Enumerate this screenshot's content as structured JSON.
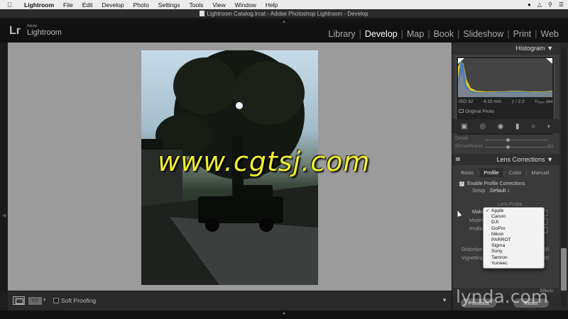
{
  "menubar": {
    "apple_icon": "apple-icon",
    "items": [
      "Lightroom",
      "File",
      "Edit",
      "Develop",
      "Photo",
      "Settings",
      "Tools",
      "View",
      "Window",
      "Help"
    ]
  },
  "window": {
    "title": "Lightroom Catalog.lrcat - Adobe Photoshop Lightroom - Develop"
  },
  "identity": {
    "logo": "Lr",
    "brand_small": "Adobe",
    "brand": "Lightroom"
  },
  "modules": {
    "items": [
      {
        "label": "Library",
        "active": false
      },
      {
        "label": "Develop",
        "active": true
      },
      {
        "label": "Map",
        "active": false
      },
      {
        "label": "Book",
        "active": false
      },
      {
        "label": "Slideshow",
        "active": false
      },
      {
        "label": "Print",
        "active": false
      },
      {
        "label": "Web",
        "active": false
      }
    ]
  },
  "histogram": {
    "title": "Histogram",
    "iso": "ISO 32",
    "focal": "4.15 mm",
    "aperture": "ƒ / 2.2",
    "shutter": "¹⁄₂₅₆₀ sec",
    "original_photo": "Original Photo"
  },
  "basic": {
    "detail_label": "Detail",
    "smoothness_label": "Smoothness",
    "smoothness_value": "50"
  },
  "lens_corrections": {
    "title": "Lens Corrections",
    "tabs": [
      {
        "label": "Basic",
        "active": false
      },
      {
        "label": "Profile",
        "active": true
      },
      {
        "label": "Color",
        "active": false
      },
      {
        "label": "Manual",
        "active": false
      }
    ],
    "enable_label": "Enable Profile Corrections",
    "setup_label": "Setup",
    "setup_value": "Default ↕",
    "lens_profile_label": "Lens Profile",
    "make_label": "Make",
    "model_label": "Model",
    "profile_label": "Profile",
    "distortion_label": "Distortion",
    "vignetting_label": "Vignetting",
    "distortion_value": "00",
    "vignetting_value": "00"
  },
  "make_dropdown": {
    "selected": "Apple",
    "options": [
      "Apple",
      "Canon",
      "DJI",
      "GoPro",
      "Nikon",
      "PARROT",
      "Sigma",
      "Sony",
      "Tamron",
      "Yuneec"
    ]
  },
  "effects_label": "Effects",
  "buttons": {
    "previous": "Previous",
    "reset": "Reset"
  },
  "toolbar": {
    "yy_label": "Y|Y",
    "soft_proofing": "Soft Proofing"
  },
  "watermarks": {
    "main": "www.cgtsj.com",
    "lynda": "lynda.com"
  }
}
